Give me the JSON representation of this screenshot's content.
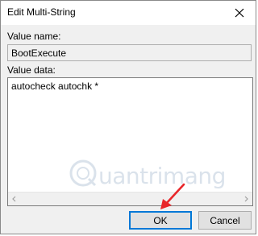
{
  "window": {
    "title": "Edit Multi-String"
  },
  "fields": {
    "value_name_label": "Value name:",
    "value_name": "BootExecute",
    "value_data_label": "Value data:",
    "value_data": "autocheck autochk *"
  },
  "buttons": {
    "ok": "OK",
    "cancel": "Cancel"
  },
  "watermark": {
    "text": "uantrimang"
  },
  "colors": {
    "accent": "#0078d7",
    "arrow": "#e8262a"
  },
  "icons": [
    "close-icon",
    "scroll-left-arrow-icon",
    "scroll-right-arrow-icon",
    "watermark-logo-icon",
    "red-pointer-arrow-icon"
  ]
}
